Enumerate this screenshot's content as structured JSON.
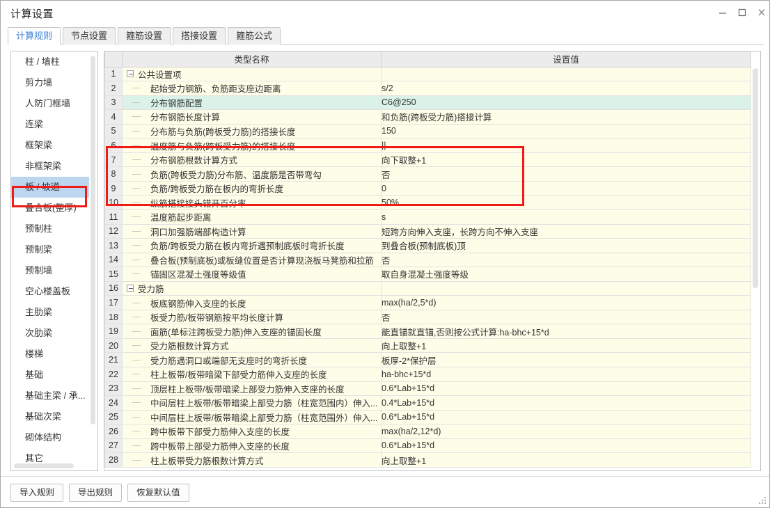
{
  "window": {
    "title": "计算设置",
    "controls": {
      "minimize": "minimize-icon",
      "maximize": "maximize-icon",
      "close": "close-icon"
    }
  },
  "tabs": [
    {
      "label": "计算规则",
      "active": true
    },
    {
      "label": "节点设置",
      "active": false
    },
    {
      "label": "箍筋设置",
      "active": false
    },
    {
      "label": "搭接设置",
      "active": false
    },
    {
      "label": "箍筋公式",
      "active": false
    }
  ],
  "sidebar": {
    "items": [
      {
        "label": "柱 / 墙柱",
        "selected": false
      },
      {
        "label": "剪力墙",
        "selected": false
      },
      {
        "label": "人防门框墙",
        "selected": false
      },
      {
        "label": "连梁",
        "selected": false
      },
      {
        "label": "框架梁",
        "selected": false
      },
      {
        "label": "非框架梁",
        "selected": false
      },
      {
        "label": "板 / 坡道",
        "selected": true
      },
      {
        "label": "叠合板(整厚)",
        "selected": false
      },
      {
        "label": "预制柱",
        "selected": false
      },
      {
        "label": "预制梁",
        "selected": false
      },
      {
        "label": "预制墙",
        "selected": false
      },
      {
        "label": "空心楼盖板",
        "selected": false
      },
      {
        "label": "主肋梁",
        "selected": false
      },
      {
        "label": "次肋梁",
        "selected": false
      },
      {
        "label": "楼梯",
        "selected": false
      },
      {
        "label": "基础",
        "selected": false
      },
      {
        "label": "基础主梁 / 承...",
        "selected": false
      },
      {
        "label": "基础次梁",
        "selected": false
      },
      {
        "label": "砌体结构",
        "selected": false
      },
      {
        "label": "其它",
        "selected": false
      }
    ]
  },
  "grid": {
    "headers": {
      "num": "",
      "name": "类型名称",
      "value": "设置值"
    },
    "rows": [
      {
        "n": "1",
        "type": "group",
        "name": "公共设置项",
        "value": ""
      },
      {
        "n": "2",
        "type": "item",
        "name": "起始受力钢筋、负筋距支座边距离",
        "value": "s/2"
      },
      {
        "n": "3",
        "type": "item",
        "name": "分布钢筋配置",
        "value": "C6@250",
        "selected": true
      },
      {
        "n": "4",
        "type": "item",
        "name": "分布钢筋长度计算",
        "value": "和负筋(跨板受力筋)搭接计算"
      },
      {
        "n": "5",
        "type": "item",
        "name": "分布筋与负筋(跨板受力筋)的搭接长度",
        "value": "150"
      },
      {
        "n": "6",
        "type": "item",
        "name": "温度筋与负筋(跨板受力筋)的搭接长度",
        "value": "||"
      },
      {
        "n": "7",
        "type": "item",
        "name": "分布钢筋根数计算方式",
        "value": "向下取整+1"
      },
      {
        "n": "8",
        "type": "item",
        "name": "负筋(跨板受力筋)分布筋、温度筋是否带弯勾",
        "value": "否"
      },
      {
        "n": "9",
        "type": "item",
        "name": "负筋/跨板受力筋在板内的弯折长度",
        "value": "0"
      },
      {
        "n": "10",
        "type": "item",
        "name": "纵筋搭接接头错开百分率",
        "value": "50%"
      },
      {
        "n": "11",
        "type": "item",
        "name": "温度筋起步距离",
        "value": "s"
      },
      {
        "n": "12",
        "type": "item",
        "name": "洞口加强筋端部构造计算",
        "value": "短跨方向伸入支座，长跨方向不伸入支座"
      },
      {
        "n": "13",
        "type": "item",
        "name": "负筋/跨板受力筋在板内弯折遇预制底板时弯折长度",
        "value": "到叠合板(预制底板)顶"
      },
      {
        "n": "14",
        "type": "item",
        "name": "叠合板(预制底板)或板缝位置是否计算现浇板马凳筋和拉筋",
        "value": "否"
      },
      {
        "n": "15",
        "type": "item",
        "name": "锚固区混凝土强度等级值",
        "value": "取自身混凝土强度等级"
      },
      {
        "n": "16",
        "type": "group",
        "name": "受力筋",
        "value": ""
      },
      {
        "n": "17",
        "type": "item",
        "name": "板底钢筋伸入支座的长度",
        "value": "max(ha/2,5*d)"
      },
      {
        "n": "18",
        "type": "item",
        "name": "板受力筋/板带钢筋按平均长度计算",
        "value": "否"
      },
      {
        "n": "19",
        "type": "item",
        "name": "面筋(单标注跨板受力筋)伸入支座的锚固长度",
        "value": "能直锚就直锚,否则按公式计算:ha-bhc+15*d"
      },
      {
        "n": "20",
        "type": "item",
        "name": "受力筋根数计算方式",
        "value": "向上取整+1"
      },
      {
        "n": "21",
        "type": "item",
        "name": "受力筋遇洞口或端部无支座时的弯折长度",
        "value": "板厚-2*保护层"
      },
      {
        "n": "22",
        "type": "item",
        "name": "柱上板带/板带暗梁下部受力筋伸入支座的长度",
        "value": "ha-bhc+15*d"
      },
      {
        "n": "23",
        "type": "item",
        "name": "顶层柱上板带/板带暗梁上部受力筋伸入支座的长度",
        "value": "0.6*Lab+15*d"
      },
      {
        "n": "24",
        "type": "item",
        "name": "中间层柱上板带/板带暗梁上部受力筋（柱宽范围内）伸入...",
        "value": "0.4*Lab+15*d"
      },
      {
        "n": "25",
        "type": "item",
        "name": "中间层柱上板带/板带暗梁上部受力筋（柱宽范围外）伸入...",
        "value": "0.6*Lab+15*d"
      },
      {
        "n": "26",
        "type": "item",
        "name": "跨中板带下部受力筋伸入支座的长度",
        "value": "max(ha/2,12*d)"
      },
      {
        "n": "27",
        "type": "item",
        "name": "跨中板带上部受力筋伸入支座的长度",
        "value": "0.6*Lab+15*d"
      },
      {
        "n": "28",
        "type": "item",
        "name": "柱上板带受力筋根数计算方式",
        "value": "向上取整+1"
      }
    ]
  },
  "footer": {
    "buttons": [
      {
        "label": "导入规则"
      },
      {
        "label": "导出规则"
      },
      {
        "label": "恢复默认值"
      }
    ]
  },
  "colors": {
    "highlight_box": "#ee1b16",
    "selected_row": "#daf2e8",
    "selected_sidebar": "#bcd6ef",
    "row_bg": "#fefde8",
    "tab_active_text": "#3c7fd4"
  }
}
